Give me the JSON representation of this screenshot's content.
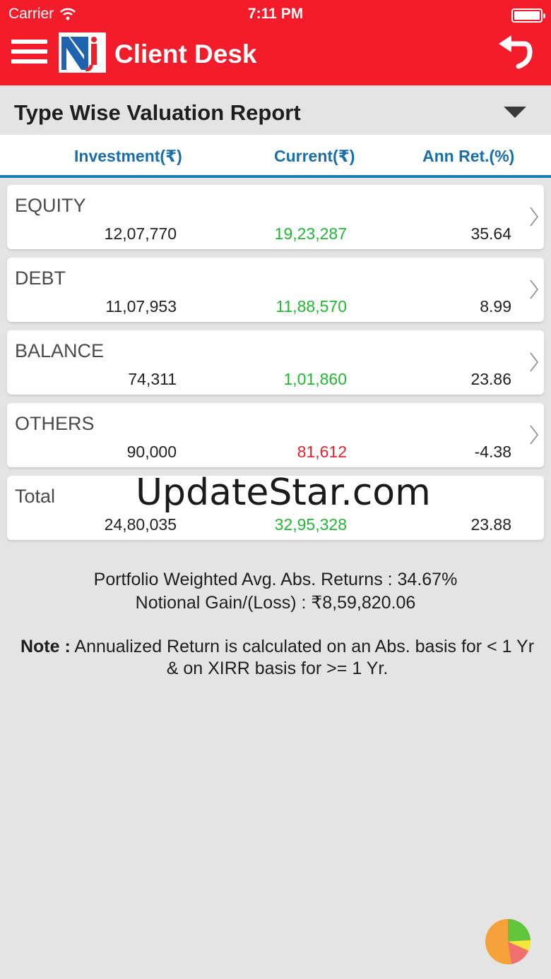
{
  "status_bar": {
    "carrier": "Carrier",
    "time": "7:11 PM"
  },
  "header": {
    "title": "Client Desk"
  },
  "report": {
    "title": "Type Wise Valuation Report"
  },
  "columns": {
    "investment": "Investment(₹)",
    "current": "Current(₹)",
    "ann_ret": "Ann Ret.(%)"
  },
  "rows": [
    {
      "name": "EQUITY",
      "investment": "12,07,770",
      "current": "19,23,287",
      "ann_ret": "35.64",
      "current_status": "gain"
    },
    {
      "name": "DEBT",
      "investment": "11,07,953",
      "current": "11,88,570",
      "ann_ret": "8.99",
      "current_status": "gain"
    },
    {
      "name": "BALANCE",
      "investment": "74,311",
      "current": "1,01,860",
      "ann_ret": "23.86",
      "current_status": "gain"
    },
    {
      "name": "OTHERS",
      "investment": "90,000",
      "current": "81,612",
      "ann_ret": "-4.38",
      "current_status": "loss"
    }
  ],
  "total": {
    "name": "Total",
    "investment": "24,80,035",
    "current": "32,95,328",
    "ann_ret": "23.88"
  },
  "watermark": "UpdateStar.com",
  "summary": {
    "weighted_returns": "Portfolio Weighted Avg. Abs. Returns : 34.67%",
    "notional_gain": "Notional Gain/(Loss) : ₹8,59,820.06"
  },
  "note": {
    "label": "Note :",
    "text": "Annualized Return is calculated on an Abs. basis for < 1 Yr & on XIRR basis for >= 1 Yr."
  },
  "colors": {
    "header_red": "#f21c2b",
    "accent_blue": "#1b6fa8",
    "gain_green": "#23b635",
    "loss_red": "#e8232b"
  },
  "icons": [
    "wifi-icon",
    "battery-icon",
    "menu-icon",
    "nj-logo",
    "back-arrow-icon",
    "dropdown-triangle-icon",
    "chevron-right-icon",
    "pie-chart-icon"
  ]
}
